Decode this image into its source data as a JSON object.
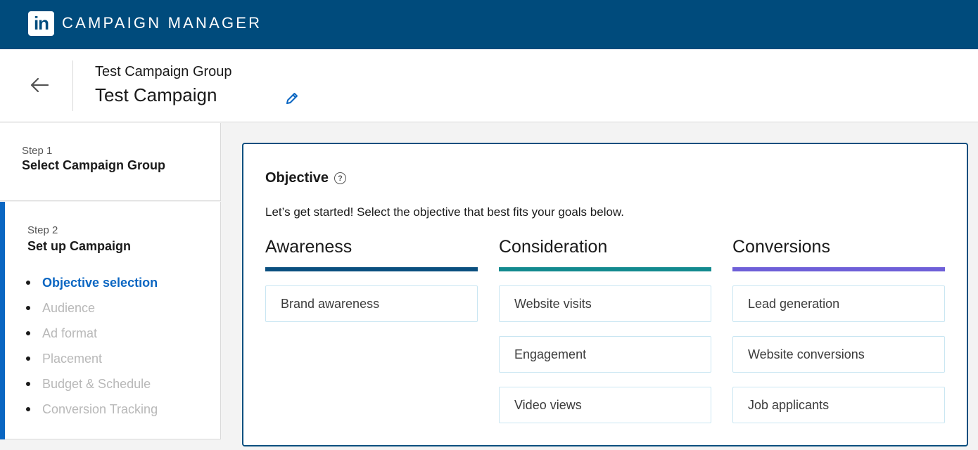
{
  "app": {
    "logo_text": "in",
    "title": "CAMPAIGN MANAGER"
  },
  "header": {
    "group_name": "Test Campaign Group",
    "campaign_name": "Test Campaign"
  },
  "sidebar": {
    "step1": {
      "number": "Step 1",
      "title": "Select Campaign Group"
    },
    "step2": {
      "number": "Step 2",
      "title": "Set up Campaign",
      "substeps": [
        {
          "label": "Objective selection",
          "active": true
        },
        {
          "label": "Audience",
          "active": false
        },
        {
          "label": "Ad format",
          "active": false
        },
        {
          "label": "Placement",
          "active": false
        },
        {
          "label": "Budget & Schedule",
          "active": false
        },
        {
          "label": "Conversion Tracking",
          "active": false
        }
      ]
    }
  },
  "objective": {
    "title": "Objective",
    "description": "Let’s get started! Select the objective that best fits your goals below.",
    "columns": [
      {
        "title": "Awareness",
        "color": "#0a4f7f",
        "options": [
          "Brand awareness"
        ]
      },
      {
        "title": "Consideration",
        "color": "#138a8f",
        "options": [
          "Website visits",
          "Engagement",
          "Video views"
        ]
      },
      {
        "title": "Conversions",
        "color": "#6e5fd8",
        "options": [
          "Lead generation",
          "Website conversions",
          "Job applicants"
        ]
      }
    ]
  },
  "colors": {
    "brand": "#004b7c",
    "accent": "#0a66c2"
  }
}
